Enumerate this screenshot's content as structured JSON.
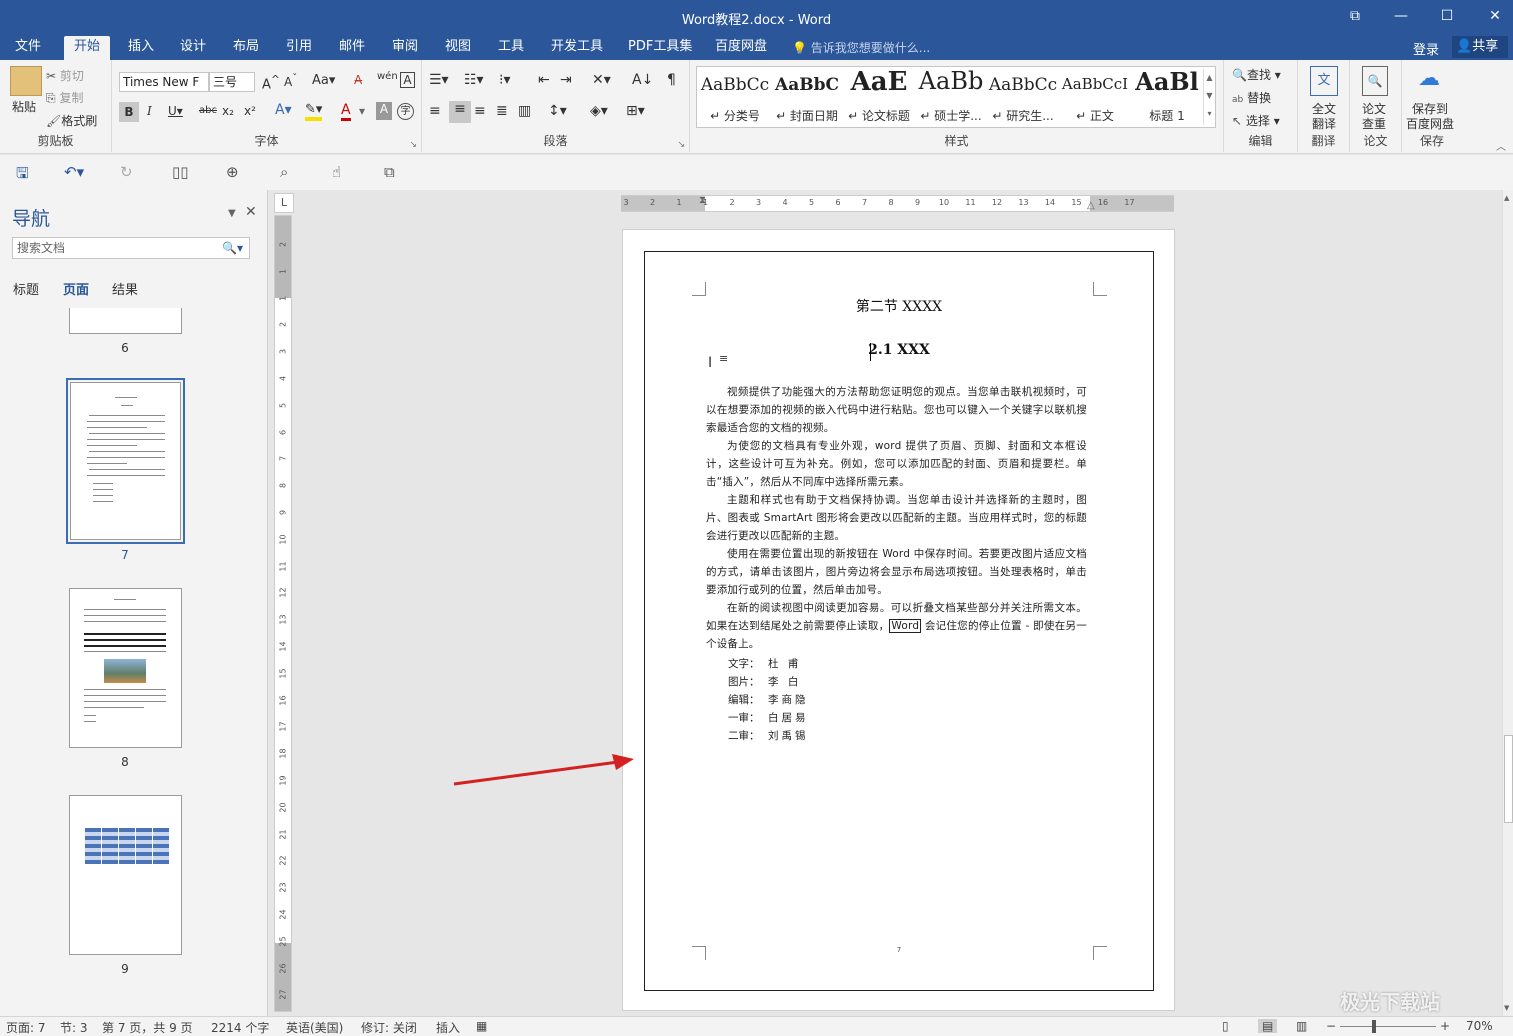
{
  "window": {
    "title": "Word教程2.docx - Word",
    "buttons": [
      "⧉",
      "—",
      "☐",
      "✕"
    ]
  },
  "tabs": [
    "文件",
    "开始",
    "插入",
    "设计",
    "布局",
    "引用",
    "邮件",
    "审阅",
    "视图",
    "工具",
    "开发工具",
    "PDF工具集",
    "百度网盘"
  ],
  "active_tab": "开始",
  "tell_me": "告诉我您想要做什么...",
  "account": {
    "login": "登录",
    "share": "共享"
  },
  "ribbon": {
    "clipboard": {
      "paste": "粘贴",
      "cut": "剪切",
      "copy": "复制",
      "format_painter": "格式刷",
      "label": "剪贴板"
    },
    "font": {
      "name": "Times New F",
      "size": "三号",
      "label": "字体"
    },
    "paragraph": {
      "label": "段落"
    },
    "styles": {
      "label": "样式",
      "items": [
        {
          "sample": "AaBbCc",
          "name": "↵ 分类号"
        },
        {
          "sample": "AaBbC",
          "name": "↵ 封面日期"
        },
        {
          "sample": "AaE",
          "name": "↵ 论文标题"
        },
        {
          "sample": "AaBb",
          "name": "↵ 硕士学..."
        },
        {
          "sample": "AaBbCc",
          "name": "↵ 研究生..."
        },
        {
          "sample": "AaBbCcI",
          "name": "↵ 正文"
        },
        {
          "sample": "AaBl",
          "name": "标题 1"
        }
      ]
    },
    "editing": {
      "find": "查找",
      "replace": "替换",
      "select": "选择",
      "label": "编辑"
    },
    "translate": {
      "btn1": "全文",
      "btn2": "翻译",
      "label": "翻译"
    },
    "paper": {
      "btn1": "论文",
      "btn2": "查重",
      "label": "论文"
    },
    "save": {
      "btn1": "保存到",
      "btn2": "百度网盘",
      "label": "保存"
    }
  },
  "nav": {
    "title": "导航",
    "search_placeholder": "搜索文档",
    "tabs": [
      "标题",
      "页面",
      "结果"
    ],
    "active_tab": "页面",
    "pages": [
      "6",
      "7",
      "8",
      "9"
    ],
    "selected_page": "7"
  },
  "ruler": {
    "h_ticks": [
      "3",
      "2",
      "1",
      "1",
      "2",
      "3",
      "4",
      "5",
      "6",
      "7",
      "8",
      "9",
      "10",
      "11",
      "12",
      "13",
      "14",
      "15",
      "16",
      "17"
    ],
    "v_ticks": [
      "2",
      "1",
      "1",
      "2",
      "3",
      "4",
      "5",
      "6",
      "7",
      "8",
      "9",
      "10",
      "11",
      "12",
      "13",
      "14",
      "15",
      "16",
      "17",
      "18",
      "19",
      "20",
      "21",
      "22",
      "23",
      "24",
      "25",
      "26",
      "27"
    ],
    "corner": "L"
  },
  "document": {
    "section_title": "第二节 XXXX",
    "heading": "2.1 XXX",
    "paragraphs": [
      "视频提供了功能强大的方法帮助您证明您的观点。当您单击联机视频时，可以在想要添加的视频的嵌入代码中进行粘贴。您也可以键入一个关键字以联机搜索最适合您的文档的视频。",
      "为使您的文档具有专业外观，word 提供了页眉、页脚、封面和文本框设计，这些设计可互为补充。例如，您可以添加匹配的封面、页眉和提要栏。单击“插入”，然后从不同库中选择所需元素。",
      "主题和样式也有助于文档保持协调。当您单击设计并选择新的主题时，图片、图表或 SmartArt 图形将会更改以匹配新的主题。当应用样式时，您的标题会进行更改以匹配新的主题。",
      "使用在需要位置出现的新按钮在 Word 中保存时间。若要更改图片适应文档的方式，请单击该图片，图片旁边将会显示布局选项按钮。当处理表格时，单击要添加行或列的位置，然后单击加号。"
    ],
    "last_paragraph": {
      "before": "在新的阅读视图中阅读更加容易。可以折叠文档某些部分并关注所需文本。如果在达到结尾处之前需要停止读取，",
      "boxed": "Word",
      "after": " 会记住您的停止位置 - 即使在另一个设备上。"
    },
    "credits": [
      {
        "label": "文字：",
        "value": "杜 甫"
      },
      {
        "label": "图片：",
        "value": "李 白"
      },
      {
        "label": "编辑：",
        "value": "李商隐"
      },
      {
        "label": "一审：",
        "value": "白居易"
      },
      {
        "label": "二审：",
        "value": "刘禹锡"
      }
    ],
    "footer_page": "7"
  },
  "status": {
    "page": "页面: 7",
    "section": "节: 3",
    "pages": "第 7 页，共 9 页",
    "words": "2214 个字",
    "language": "英语(美国)",
    "track": "修订: 关闭",
    "mode": "插入",
    "zoom": "70%"
  },
  "watermark": "极光下载站",
  "colors": {
    "brand": "#2b579a",
    "arrow": "#d42020"
  }
}
